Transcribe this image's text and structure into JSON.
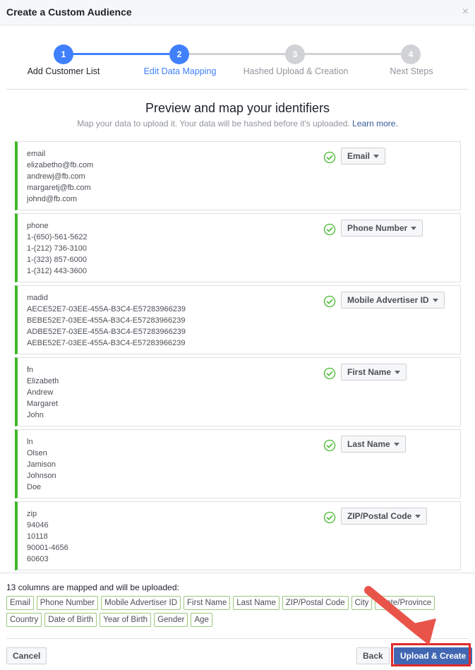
{
  "dialog": {
    "title": "Create a Custom Audience",
    "close_icon": "×"
  },
  "stepper": {
    "steps": [
      {
        "number": "1",
        "label": "Add Customer List",
        "state": "done"
      },
      {
        "number": "2",
        "label": "Edit Data Mapping",
        "state": "current"
      },
      {
        "number": "3",
        "label": "Hashed Upload & Creation",
        "state": "future"
      },
      {
        "number": "4",
        "label": "Next Steps",
        "state": "future"
      }
    ]
  },
  "main": {
    "title": "Preview and map your identifiers",
    "subtitle": "Map your data to upload it. Your data will be hashed before it's uploaded.",
    "learn_more": "Learn more."
  },
  "columns": [
    {
      "header": "email",
      "values": [
        "elizabetho@fb.com",
        "andrewj@fb.com",
        "margaretj@fb.com",
        "johnd@fb.com"
      ],
      "mapping": "Email",
      "status": "check-circle-icon"
    },
    {
      "header": "phone",
      "values": [
        "1-(650)-561-5622",
        "1-(212) 736-3100",
        "1-(323) 857-6000",
        "1-(312) 443-3600"
      ],
      "mapping": "Phone Number",
      "status": "check-circle-icon"
    },
    {
      "header": "madid",
      "values": [
        "AECE52E7-03EE-455A-B3C4-E57283966239",
        "BEBE52E7-03EE-455A-B3C4-E57283966239",
        "ADBE52E7-03EE-455A-B3C4-E57283966239",
        "AEBE52E7-03EE-455A-B3C4-E57283966239"
      ],
      "mapping": "Mobile Advertiser ID",
      "status": "check-circle-icon"
    },
    {
      "header": "fn",
      "values": [
        "Elizabeth",
        "Andrew",
        "Margaret",
        "John"
      ],
      "mapping": "First Name",
      "status": "check-circle-icon"
    },
    {
      "header": "ln",
      "values": [
        "Olsen",
        "Jamison",
        "Johnson",
        "Doe"
      ],
      "mapping": "Last Name",
      "status": "check-circle-icon"
    },
    {
      "header": "zip",
      "values": [
        "94046",
        "10118",
        "90001-4656",
        "60603"
      ],
      "mapping": "ZIP/Postal Code",
      "status": "check-circle-icon"
    }
  ],
  "summary": {
    "text": "13 columns are mapped and will be uploaded:",
    "tags": [
      "Email",
      "Phone Number",
      "Mobile Advertiser ID",
      "First Name",
      "Last Name",
      "ZIP/Postal Code",
      "City",
      "State/Province",
      "Country",
      "Date of Birth",
      "Year of Birth",
      "Gender",
      "Age"
    ]
  },
  "footer": {
    "cancel": "Cancel",
    "back": "Back",
    "upload_create": "Upload & Create"
  },
  "colors": {
    "accent": "#4080ff",
    "primary_button": "#4267b2",
    "mapped_green": "#42b72a",
    "annotation_red": "#e02a2a"
  }
}
